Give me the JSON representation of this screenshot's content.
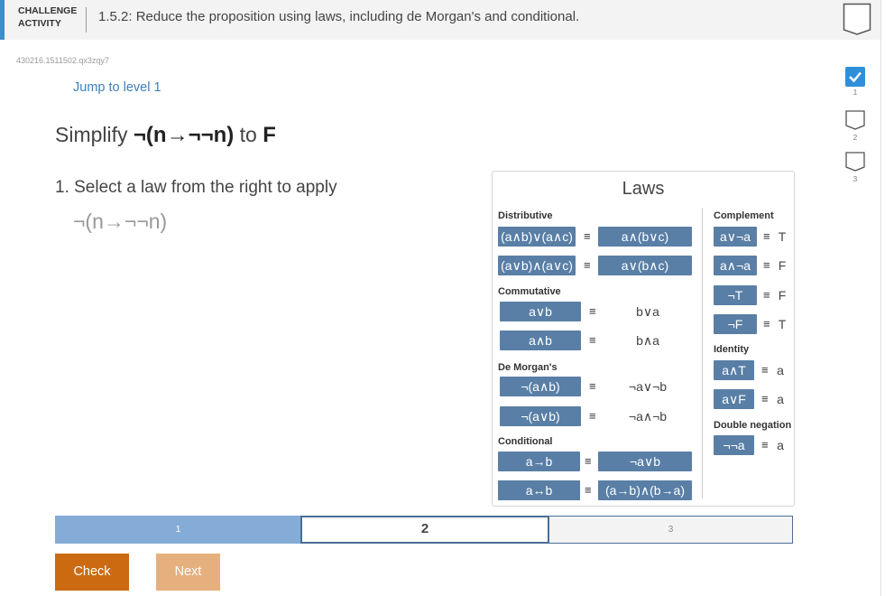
{
  "header": {
    "label_line1": "CHALLENGE",
    "label_line2": "ACTIVITY",
    "title": "1.5.2: Reduce the proposition using laws, including de Morgan's and conditional."
  },
  "seed": "430216.1511502.qx3zqy7",
  "jump_link": "Jump to level 1",
  "prompt": {
    "prefix": "Simplify",
    "expr": "¬(n→¬¬n)",
    "mid": "to",
    "target": "F"
  },
  "step_instruction": "1. Select a law from the right to apply",
  "current_expression": "¬(n→¬¬n)",
  "laws": {
    "title": "Laws",
    "eq": "≡",
    "distributive": {
      "label": "Distributive",
      "rows": [
        {
          "left": "(a∧b)∨(a∧c)",
          "right": "a∧(b∨c)"
        },
        {
          "left": "(a∨b)∧(a∨c)",
          "right": "a∨(b∧c)"
        }
      ]
    },
    "commutative": {
      "label": "Commutative",
      "rows": [
        {
          "left": "a∨b",
          "right": "b∨a"
        },
        {
          "left": "a∧b",
          "right": "b∧a"
        }
      ]
    },
    "demorgan": {
      "label": "De Morgan's",
      "rows": [
        {
          "left": "¬(a∧b)",
          "right": "¬a∨¬b"
        },
        {
          "left": "¬(a∨b)",
          "right": "¬a∧¬b"
        }
      ]
    },
    "conditional": {
      "label": "Conditional",
      "rows": [
        {
          "left": "a→b",
          "right": "¬a∨b"
        },
        {
          "left": "a↔b",
          "right": "(a→b)∧(b→a)"
        }
      ]
    },
    "complement": {
      "label": "Complement",
      "rows": [
        {
          "left": "a∨¬a",
          "right": "T"
        },
        {
          "left": "a∧¬a",
          "right": "F"
        },
        {
          "left": "¬T",
          "right": "F"
        },
        {
          "left": "¬F",
          "right": "T"
        }
      ]
    },
    "identity": {
      "label": "Identity",
      "rows": [
        {
          "left": "a∧T",
          "right": "a"
        },
        {
          "left": "a∨F",
          "right": "a"
        }
      ]
    },
    "double_negation": {
      "label": "Double negation",
      "rows": [
        {
          "left": "¬¬a",
          "right": "a"
        }
      ]
    }
  },
  "level_indicators": [
    "1",
    "2",
    "3"
  ],
  "progress": {
    "segments": [
      "1",
      "2",
      "3"
    ],
    "current": 2
  },
  "buttons": {
    "check": "Check",
    "next": "Next"
  },
  "colors": {
    "accent": "#3c8dc8",
    "law_button": "#5a7fa6",
    "check": "#cc6a12",
    "next": "#e6b07e"
  }
}
